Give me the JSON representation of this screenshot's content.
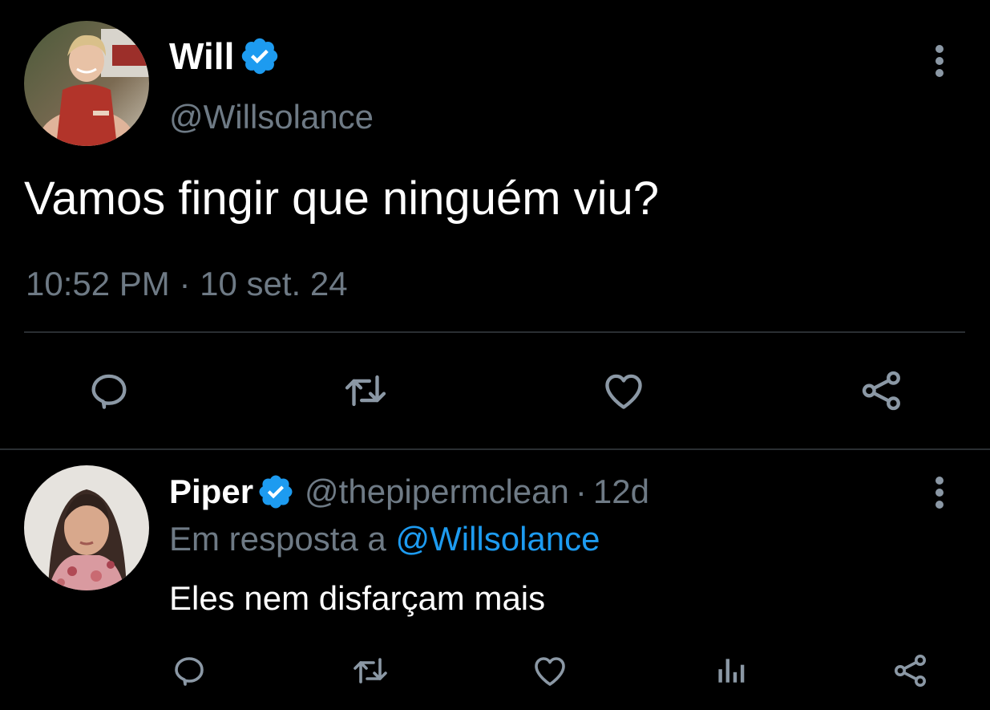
{
  "main_tweet": {
    "author_name": "Will",
    "author_handle": "@Willsolance",
    "text": "Vamos fingir que ninguém viu?",
    "time": "10:52 PM",
    "separator": "·",
    "date": "10 set. 24"
  },
  "reply": {
    "author_name": "Piper",
    "author_handle": "@thepipermclean",
    "separator": "·",
    "age": "12d",
    "reply_prefix": "Em resposta a",
    "reply_to": "@Willsolance",
    "text": "Eles nem disfarçam mais"
  },
  "colors": {
    "background": "#000000",
    "accent": "#1d9bf0",
    "muted_text": "#6e7a85",
    "icon": "#8b98a5"
  },
  "icons": {
    "main_actions": [
      "reply-icon",
      "retweet-icon",
      "like-icon",
      "share-icon"
    ],
    "reply_actions": [
      "reply-icon",
      "retweet-icon",
      "like-icon",
      "analytics-icon",
      "share-icon"
    ],
    "more": "more-vertical-icon",
    "verified": "verified-badge-icon"
  }
}
